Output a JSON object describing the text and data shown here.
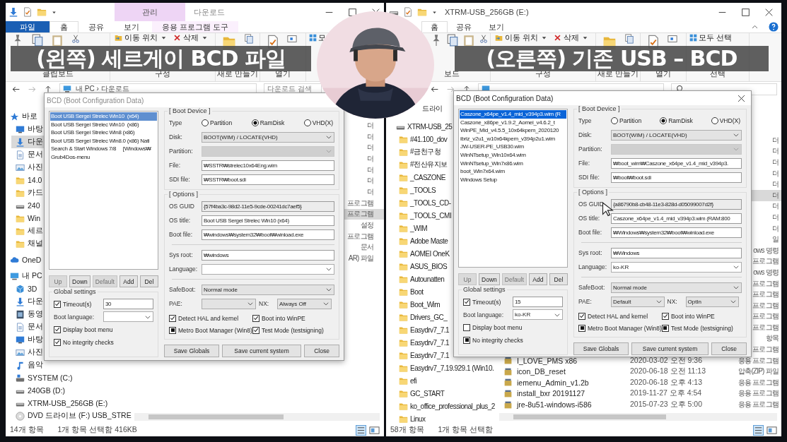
{
  "captions": [
    {
      "text": "(왼쪽) 세르게이 BCD 파일"
    },
    {
      "text": "(오른쪽) 기존 USB – BCD"
    }
  ],
  "panes": [
    {
      "title": {
        "text": "다운로드",
        "kind": "downloads"
      },
      "context_header": "관리",
      "tabs": [
        {
          "label": "파일",
          "kind": "file",
          "selected": false
        },
        {
          "label": "홈",
          "kind": "normal",
          "selected": true
        },
        {
          "label": "공유",
          "kind": "normal",
          "selected": false
        },
        {
          "label": "보기",
          "kind": "normal",
          "selected": false
        },
        {
          "label": "응용 프로그램 도구",
          "kind": "context",
          "selected": false
        }
      ],
      "ribbon": [
        {
          "kind": "clipboard",
          "label": "클립보드"
        },
        {
          "kind": "organize",
          "label": "구성",
          "items": [
            "이동 위치",
            "삭제"
          ]
        },
        {
          "kind": "new",
          "label": "새로 만들기"
        },
        {
          "kind": "open",
          "label": "열기"
        },
        {
          "kind": "select",
          "items": [
            "모"
          ]
        }
      ],
      "address": "내 PC › 다운로드",
      "search_placeholder": "다운로드 검색",
      "nav": [
        {
          "label": "바로",
          "kind": "quick",
          "selected": false,
          "children": [
            {
              "label": "바탕",
              "kind": "desktop",
              "selected": false
            },
            {
              "label": "다운",
              "kind": "download",
              "selected": true
            },
            {
              "label": "문서",
              "kind": "doc",
              "selected": false
            },
            {
              "label": "사진",
              "selected": false
            },
            {
              "label": "14.0",
              "kind": "folder",
              "selected": false
            },
            {
              "label": "카드",
              "kind": "folder",
              "selected": false
            },
            {
              "label": "240",
              "kind": "drive",
              "selected": false
            },
            {
              "label": "Win",
              "kind": "folder",
              "selected": false
            },
            {
              "label": "세르",
              "kind": "folder",
              "selected": false
            },
            {
              "label": "채널",
              "kind": "folder",
              "selected": false
            }
          ]
        },
        {
          "label": "OneD",
          "kind": "cloud",
          "selected": false
        },
        {
          "label": "내 PC",
          "kind": "pc",
          "selected": false,
          "children": [
            {
              "label": "3D",
              "kind": "cube",
              "selected": false
            },
            {
              "label": "다운",
              "kind": "download",
              "selected": false
            },
            {
              "label": "동영",
              "kind": "film",
              "selected": false
            },
            {
              "label": "문서",
              "kind": "doc",
              "selected": false
            },
            {
              "label": "바탕",
              "kind": "desktop",
              "selected": false
            },
            {
              "label": "사진",
              "selected": false
            },
            {
              "label": "음악",
              "kind": "music",
              "selected": false
            },
            {
              "label": "SYSTEM (C:)",
              "kind": "system",
              "selected": false
            },
            {
              "label": "240GB (D:)",
              "kind": "drive",
              "selected": false
            },
            {
              "label": "XTRM-USB_256GB (E:)",
              "kind": "drive",
              "selected": false
            },
            {
              "label": "DVD 드라이브 (F:) USB_STRE",
              "kind": "disc",
              "selected": false
            }
          ]
        }
      ],
      "files": [
        {
          "type": "더",
          "selected": false
        },
        {
          "type": "더",
          "selected": false
        },
        {
          "type": "더",
          "selected": false
        },
        {
          "type": "더",
          "selected": false
        },
        {
          "type": "더",
          "selected": false
        },
        {
          "type": "더",
          "selected": false
        },
        {
          "type": "더",
          "selected": false
        },
        {
          "type": "프로그램",
          "selected": false
        },
        {
          "type": "프로그램",
          "selected": true
        },
        {
          "type": "설정",
          "selected": false
        },
        {
          "type": "프로그램",
          "selected": false
        },
        {
          "type": "문서",
          "selected": false
        },
        {
          "type": "AR) 파일",
          "selected": false
        }
      ],
      "status": [
        "14개 항목",
        "1개 항목 선택함 416KB"
      ],
      "dialog": {
        "title": "BCD (Boot Configuration Data)",
        "active": false,
        "entries": [
          {
            "label": "Boot USB Sergei Strelec Win10  (x64)",
            "selected": true
          },
          {
            "label": "Boot USB Sergei Strelec Win10  (x86)",
            "selected": false
          },
          {
            "label": "Boot USB Sergei Strelec Win8 (x86)",
            "selected": false
          },
          {
            "label": "Boot USB Sergei Strelec Win8.0 (x86) Nati",
            "selected": false
          },
          {
            "label": "Search & Start Windows 7/8     [Windows₩",
            "selected": false
          },
          {
            "label": "Grub4Dos-menu",
            "selected": false
          }
        ],
        "entry_buttons": [
          {
            "label": "Up",
            "disabled": true
          },
          {
            "label": "Down",
            "disabled": false
          },
          {
            "label": "Default",
            "disabled": true
          },
          {
            "label": "Add",
            "disabled": false
          },
          {
            "label": "Del",
            "disabled": false
          }
        ],
        "global": {
          "title": "Global settings",
          "timeout": {
            "label": "Timeout(s)",
            "checked": true,
            "value": "30"
          },
          "boot_language": {
            "label": "Boot language:"
          },
          "checks": [
            {
              "label": "Display boot menu",
              "checked": true
            },
            {
              "label": "No integrity checks",
              "checked": true
            }
          ]
        },
        "boot_device": {
          "title": "[ Boot Device ]",
          "type_label": "Type",
          "radios": [
            {
              "label": "Partition",
              "selected": false
            },
            {
              "label": "RamDisk",
              "selected": true
            },
            {
              "label": "VHD(X)",
              "selected": false
            }
          ],
          "fields": [
            {
              "kind": "select",
              "label": "Disk:",
              "value": "BOOT(WIM) / LOCATE(VHD)",
              "disabled": false
            },
            {
              "kind": "select",
              "label": "Partition:",
              "disabled": true
            },
            {
              "kind": "input",
              "label": "File:",
              "value": "₩SSTR₩strelec10x64Eng.wim"
            },
            {
              "kind": "input",
              "label": "SDI file:",
              "value": "₩SSTR₩boot.sdi"
            }
          ]
        },
        "options": {
          "title": "[ Options ]",
          "fields": [
            {
              "kind": "readonly",
              "label": "OS GUID",
              "value": "{57f4ba3c-98d2-11e5-9cde-00241dc7aef5}"
            },
            {
              "kind": "input",
              "label": "OS title:",
              "value": "Boot USB Sergei Strelec Win10  (x64)"
            },
            {
              "kind": "input",
              "label": "Boot file:",
              "value": "₩windows₩system32₩boot₩winload.exe"
            },
            {
              "kind": "separator"
            },
            {
              "kind": "input",
              "label": "Sys root:",
              "value": "₩windows"
            },
            {
              "kind": "combo",
              "label": "Language:"
            },
            {
              "kind": "separator"
            },
            {
              "kind": "select",
              "label": "SafeBoot:",
              "value": "Normal mode",
              "disabled": false
            },
            {
              "kind": "pair",
              "items": [
                {
                  "kind": "select",
                  "label": "PAE:",
                  "disabled": false
                },
                {
                  "kind": "select",
                  "label": "NX:",
                  "value": "Always Off",
                  "disabled": false
                }
              ]
            }
          ],
          "checks": [
            {
              "label": "Detect HAL and kernel",
              "checked": true
            },
            {
              "label": "Boot into WinPE",
              "checked": true
            },
            {
              "label": "Metro Boot Manager (Win8)",
              "indeterminate": true
            },
            {
              "label": "Test Mode (testsigning)",
              "checked": true
            }
          ]
        },
        "footer_buttons": [
          "Save Globals",
          "Save current system",
          "Close"
        ]
      }
    },
    {
      "title": {
        "text": "XTRM-USB_256GB (E:)",
        "kind": "drive"
      },
      "tabs": [
        {
          "label": "홈",
          "kind": "normal",
          "selected": true
        },
        {
          "label": "공유",
          "kind": "normal",
          "selected": false
        },
        {
          "label": "보기",
          "kind": "normal",
          "selected": false
        }
      ],
      "ribbon": [
        {
          "kind": "clipboard",
          "label": "보드"
        },
        {
          "kind": "organize",
          "label": "구성",
          "items": [
            "이동 위치",
            "삭제"
          ]
        },
        {
          "kind": "new",
          "label": "새로 만들기"
        },
        {
          "kind": "open",
          "label": "열기"
        },
        {
          "kind": "select",
          "label": "선택",
          "items": [
            "모두 선택"
          ]
        }
      ],
      "nav": [
        {
          "label": "드라이",
          "kind": "partial",
          "selected": false
        },
        {
          "label": "XTRM-USB_25",
          "kind": "drive",
          "selected": false,
          "children": [
            {
              "label": "#41.100_dov",
              "kind": "folder",
              "selected": false
            },
            {
              "label": "#금천구청",
              "kind": "folder",
              "selected": false
            },
            {
              "label": "#전산유지보",
              "kind": "folder",
              "selected": false
            },
            {
              "label": "_CASZONE",
              "kind": "folder",
              "selected": false
            },
            {
              "label": "_TOOLS",
              "kind": "folder",
              "selected": false
            },
            {
              "label": "_TOOLS_CD-",
              "kind": "folder",
              "selected": false
            },
            {
              "label": "_TOOLS_CMI",
              "kind": "folder",
              "selected": false
            },
            {
              "label": "_WIM",
              "kind": "folder",
              "selected": false
            },
            {
              "label": "Adobe Maste",
              "kind": "folder",
              "selected": false
            },
            {
              "label": "AOMEI OneK",
              "kind": "folder",
              "selected": false
            },
            {
              "label": "ASUS_BIOS",
              "kind": "folder",
              "selected": false
            },
            {
              "label": "Autounatten",
              "kind": "folder",
              "selected": false
            },
            {
              "label": "Boot",
              "kind": "folder",
              "selected": false
            },
            {
              "label": "Boot_Wim",
              "kind": "folder",
              "selected": false
            },
            {
              "label": "Drivers_GC_",
              "kind": "folder",
              "selected": false
            },
            {
              "label": "Easydrv7_7.1",
              "kind": "folder",
              "selected": false
            },
            {
              "label": "Easydrv7_7.1",
              "kind": "folder",
              "selected": false
            },
            {
              "label": "Easydrv7_7.1",
              "kind": "folder",
              "selected": false
            },
            {
              "label": "Easydrv7_7.19.929.1 (Win10.",
              "kind": "folder",
              "selected": false
            },
            {
              "label": "efi",
              "kind": "folder",
              "selected": false
            },
            {
              "label": "GC_START",
              "kind": "folder",
              "selected": false
            },
            {
              "label": "ko_office_professional_plus_2",
              "kind": "folder",
              "selected": false
            },
            {
              "label": "Linux",
              "kind": "folder",
              "selected": false
            }
          ]
        }
      ],
      "files": [
        {
          "type": "더",
          "selected": false
        },
        {
          "type": "더",
          "selected": false
        },
        {
          "type": "더",
          "selected": false
        },
        {
          "type": "더",
          "selected": false
        },
        {
          "type": "더",
          "selected": false
        },
        {
          "type": "더",
          "selected": true
        },
        {
          "type": "더",
          "selected": false
        },
        {
          "type": "더",
          "selected": false
        },
        {
          "type": "더",
          "selected": false
        },
        {
          "type": "일",
          "selected": false
        },
        {
          "type": "ows 명령",
          "selected": false
        },
        {
          "type": "프로그램",
          "selected": false
        },
        {
          "type": "ows 명령",
          "selected": false
        },
        {
          "type": "프로그램",
          "selected": false
        },
        {
          "type": "프로그램",
          "selected": false
        },
        {
          "type": "프로그램",
          "selected": false
        },
        {
          "type": "프로그램",
          "selected": false
        },
        {
          "type": "프로그램",
          "selected": false
        },
        {
          "type": "항목",
          "selected": false
        },
        {
          "type": "프로그램",
          "selected": false
        },
        {
          "name": "I_LOVE_PMS x86",
          "date": "2020-03-02 오전 9:36",
          "type": "응용 프로그램",
          "selected": false
        },
        {
          "name": "icon_DB_reset",
          "date": "2020-06-18 오전 11:13",
          "type": "압축(ZIP) 파일",
          "selected": false
        },
        {
          "name": "iemenu_Admin_v1.2b",
          "date": "2020-06-18 오후 4:13",
          "type": "응용 프로그램",
          "selected": false
        },
        {
          "name": "install_bxr 20191127",
          "date": "2019-11-27 오후 4:54",
          "type": "응용 프로그램",
          "selected": false
        },
        {
          "name": "jre-8u51-windows-i586",
          "date": "2015-07-23 오후 5:00",
          "type": "응용 프로그램",
          "selected": false
        }
      ],
      "status": [
        "58개 항목",
        "1개 항목 선택함"
      ],
      "dialog": {
        "title": "BCD (Boot Configuration Data)",
        "active": true,
        "close": true,
        "entries": [
          {
            "label": "Caszone_x64pe_v1.4_mid_v394p3.wim (R",
            "selected": true
          },
          {
            "label": "Caszone_x86pe_v1.9.2_Aomei_v4.6.2_t",
            "selected": false
          },
          {
            "label": "WinPE_Mid_v4.5.5_10x64kpem_2020120",
            "selected": false
          },
          {
            "label": "ibriz_v2u1_w10x64kpem_v394p2u1.wim",
            "selected": false
          },
          {
            "label": "JW-USER-PE_USB30.wim",
            "selected": false
          },
          {
            "label": "WinNTsetup_Win10x64.wim",
            "selected": false
          },
          {
            "label": "WinNTsetup_Win7x86.wim",
            "selected": false
          },
          {
            "label": "boot_Win7x64.wim",
            "selected": false
          },
          {
            "label": "Windows Setup",
            "selected": false
          }
        ],
        "entry_buttons": [
          {
            "label": "Up",
            "disabled": true
          },
          {
            "label": "Down",
            "disabled": false
          },
          {
            "label": "Default",
            "disabled": true
          },
          {
            "label": "Add",
            "disabled": false
          },
          {
            "label": "Del",
            "disabled": false
          }
        ],
        "global": {
          "title": "Global settings",
          "timeout": {
            "label": "Timeout(s)",
            "checked": true,
            "value": "15"
          },
          "boot_language": {
            "label": "Boot language:",
            "value": "ko-KR"
          },
          "checks": [
            {
              "label": "Display boot menu",
              "checked": false
            },
            {
              "label": "No integrity checks",
              "indeterminate": true
            }
          ]
        },
        "boot_device": {
          "title": "[ Boot Device ]",
          "type_label": "Type",
          "radios": [
            {
              "label": "Partition",
              "selected": false
            },
            {
              "label": "RamDisk",
              "selected": true
            },
            {
              "label": "VHD(X)",
              "selected": false
            }
          ],
          "fields": [
            {
              "kind": "select",
              "label": "Disk:",
              "value": "BOOT(WIM) / LOCATE(VHD)",
              "disabled": false
            },
            {
              "kind": "select",
              "label": "Partition:",
              "disabled": true
            },
            {
              "kind": "input",
              "label": "File:",
              "value": "₩boot_wim₩Caszone_x64pe_v1.4_mid_v394p3."
            },
            {
              "kind": "input",
              "label": "SDI file:",
              "value": "₩boot₩boot.sdi"
            }
          ]
        },
        "options": {
          "title": "[ Options ]",
          "fields": [
            {
              "kind": "readonly",
              "label": "OS GUID",
              "value": "{a86790b8-cb48-11e3-828d-d05099007d2f}"
            },
            {
              "kind": "input",
              "label": "OS title:",
              "value": "Caszone_x64pe_v1.4_mid_v394p3.wim (RAM:800"
            },
            {
              "kind": "input",
              "label": "Boot file:",
              "value": "₩Windows₩system32₩boot₩winload.exe"
            },
            {
              "kind": "separator"
            },
            {
              "kind": "input",
              "label": "Sys root:",
              "value": "₩Windows"
            },
            {
              "kind": "combo",
              "label": "Language:",
              "value": "ko-KR"
            },
            {
              "kind": "separator"
            },
            {
              "kind": "select",
              "label": "SafeBoot:",
              "value": "Normal mode",
              "disabled": false
            },
            {
              "kind": "pair",
              "items": [
                {
                  "kind": "select",
                  "label": "PAE:",
                  "value": "Default",
                  "disabled": false
                },
                {
                  "kind": "select",
                  "label": "NX:",
                  "value": "OptIn",
                  "disabled": false
                }
              ]
            }
          ],
          "checks": [
            {
              "label": "Detect HAL and kernel",
              "checked": true
            },
            {
              "label": "Boot into WinPE",
              "checked": true
            },
            {
              "label": "Metro Boot Manager (Win8)",
              "indeterminate": true
            },
            {
              "label": "Test Mode (testsigning)",
              "indeterminate": true
            }
          ]
        },
        "footer_buttons": [
          "Save Globals",
          "Save current system",
          "Close"
        ]
      }
    }
  ]
}
